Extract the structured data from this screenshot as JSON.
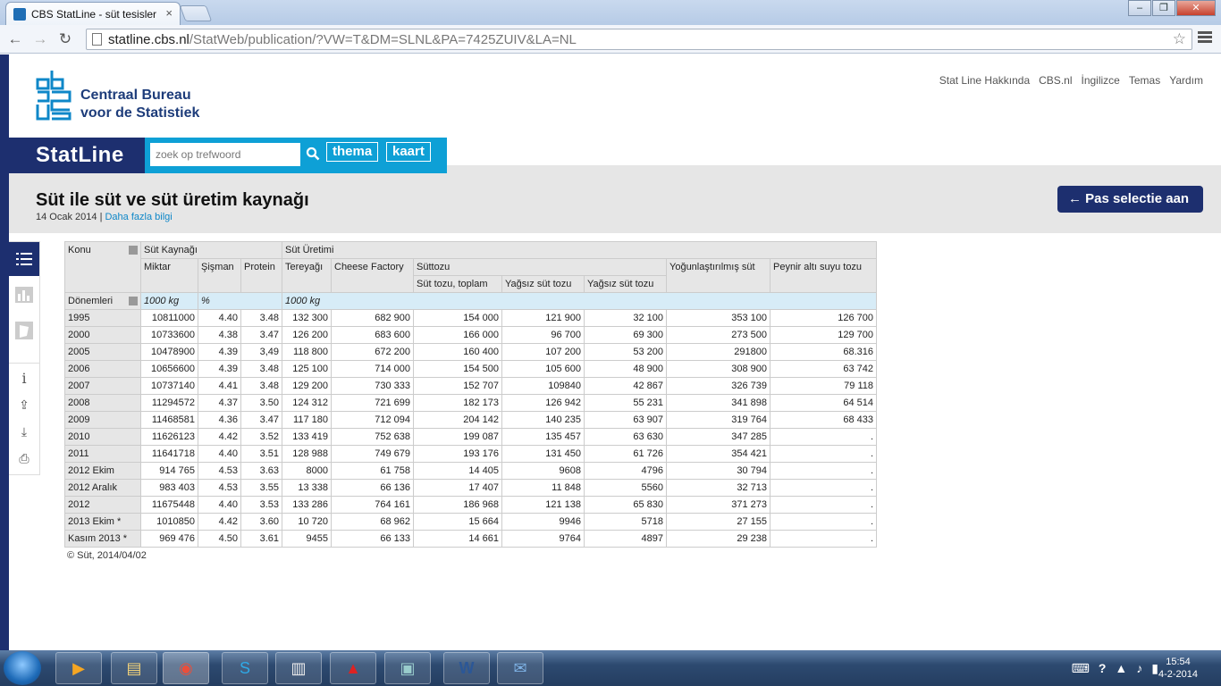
{
  "browser": {
    "tab_title": "CBS StatLine - süt tesisleri",
    "url_host": "statline.cbs.nl",
    "url_path": "/StatWeb/publication/?VW=T&DM=SLNL&PA=7425ZUIV&LA=NL"
  },
  "header": {
    "logo_line1": "Centraal Bureau",
    "logo_line2": "voor de Statistiek",
    "links": [
      "Stat Line Hakkında",
      "CBS.nl",
      "İngilizce",
      "Temas",
      "Yardım"
    ]
  },
  "statline": {
    "label": "StatLine",
    "search_placeholder": "zoek op trefwoord",
    "thema": "thema",
    "kaart": "kaart"
  },
  "title_band": {
    "title": "Süt ile süt ve süt üretim kaynağı",
    "date": "14 Ocak 2014",
    "separator": "|",
    "more_info": "Daha fazla bilgi",
    "pas_button": "Pas selectie aan"
  },
  "table": {
    "konu": "Konu",
    "donemleri": "Dönemleri",
    "group1": "Süt Kaynağı",
    "group2": "Süt Üretimi",
    "col_miktar": "Miktar",
    "col_sisman": "Şişman",
    "col_protein": "Protein",
    "col_tereyagi": "Tereyağı",
    "col_cheese": "Cheese Factory",
    "col_suttozu": "Süttozu",
    "col_yogun": "Yoğunlaştırılmış süt",
    "col_peynir": "Peynir altı suyu tozu",
    "sub_toplam": "Süt tozu, toplam",
    "sub_yagsiz1": "Yağsız süt tozu",
    "sub_yagsiz2": "Yağsız süt tozu",
    "unit_1000kg": "1000 kg",
    "unit_pct": "%",
    "unit_1000kg2": "1000 kg",
    "rows": [
      [
        "1995",
        "10811000",
        "4.40",
        "3.48",
        "132 300",
        "682 900",
        "154 000",
        "121 900",
        "32 100",
        "353 100",
        "126 700"
      ],
      [
        "2000",
        "10733600",
        "4.38",
        "3.47",
        "126 200",
        "683 600",
        "166 000",
        "96 700",
        "69 300",
        "273 500",
        "129 700"
      ],
      [
        "2005",
        "10478900",
        "4.39",
        "3,49",
        "118 800",
        "672 200",
        "160 400",
        "107 200",
        "53 200",
        "291800",
        "68.316"
      ],
      [
        "2006",
        "10656600",
        "4.39",
        "3.48",
        "125 100",
        "714 000",
        "154 500",
        "105 600",
        "48 900",
        "308 900",
        "63 742"
      ],
      [
        "2007",
        "10737140",
        "4.41",
        "3.48",
        "129 200",
        "730 333",
        "152 707",
        "109840",
        "42 867",
        "326 739",
        "79 118"
      ],
      [
        "2008",
        "11294572",
        "4.37",
        "3.50",
        "124 312",
        "721 699",
        "182 173",
        "126 942",
        "55 231",
        "341 898",
        "64 514"
      ],
      [
        "2009",
        "11468581",
        "4.36",
        "3.47",
        "117 180",
        "712 094",
        "204 142",
        "140 235",
        "63 907",
        "319 764",
        "68 433"
      ],
      [
        "2010",
        "11626123",
        "4.42",
        "3.52",
        "133 419",
        "752 638",
        "199 087",
        "135 457",
        "63 630",
        "347 285",
        "."
      ],
      [
        "2011",
        "11641718",
        "4.40",
        "3.51",
        "128 988",
        "749 679",
        "193 176",
        "131 450",
        "61 726",
        "354 421",
        "."
      ],
      [
        "2012 Ekim",
        "914 765",
        "4.53",
        "3.63",
        "8000",
        "61 758",
        "14 405",
        "9608",
        "4796",
        "30 794",
        "."
      ],
      [
        "2012 Aralık",
        "983 403",
        "4.53",
        "3.55",
        "13 338",
        "66 136",
        "17 407",
        "11 848",
        "5560",
        "32 713",
        "."
      ],
      [
        "2012",
        "11675448",
        "4.40",
        "3.53",
        "133 286",
        "764 161",
        "186 968",
        "121 138",
        "65 830",
        "371 273",
        "."
      ],
      [
        "2013 Ekim *",
        "1010850",
        "4.42",
        "3.60",
        "10 720",
        "68 962",
        "15 664",
        "9946",
        "5718",
        "27 155",
        "."
      ],
      [
        "Kasım 2013 *",
        "969 476",
        "4.50",
        "3.61",
        "9455",
        "66 133",
        "14 661",
        "9764",
        "4897",
        "29 238",
        "."
      ]
    ],
    "footnote": "© Süt, 2014/04/02"
  },
  "taskbar": {
    "time": "15:54",
    "date": "4-2-2014"
  }
}
